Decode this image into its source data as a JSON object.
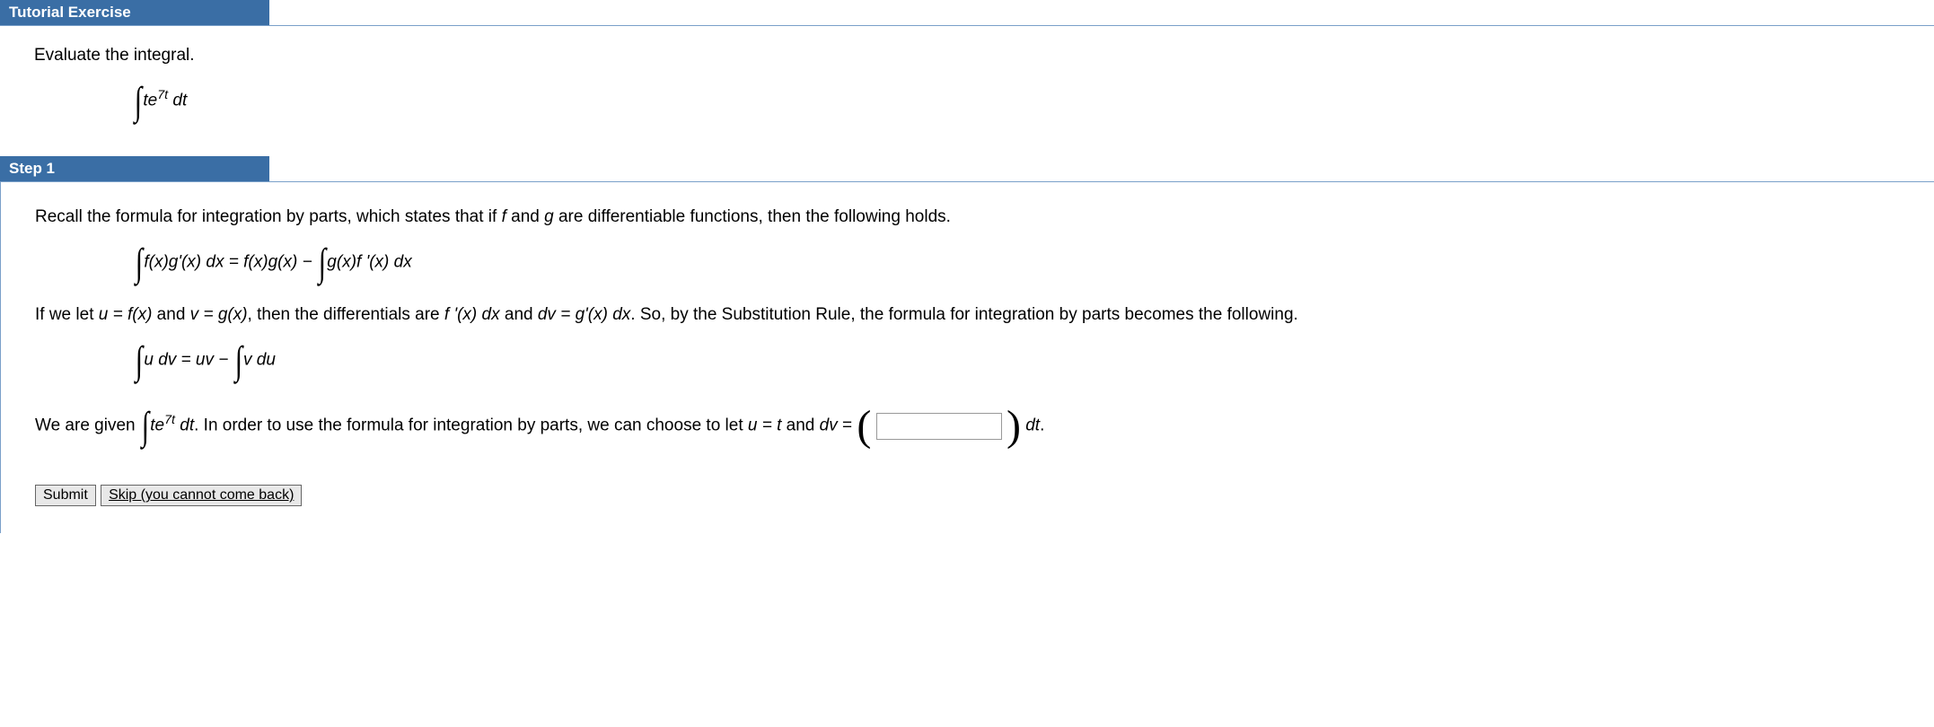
{
  "headers": {
    "tutorial": "Tutorial Exercise",
    "step1": "Step 1"
  },
  "exercise": {
    "prompt": "Evaluate the integral.",
    "integrand_base": "te",
    "integrand_exp": "7t",
    "differential": " dt"
  },
  "step1": {
    "intro_a": "Recall the formula for integration by parts, which states that if ",
    "intro_f": "f",
    "intro_b": " and ",
    "intro_g": "g",
    "intro_c": " are differentiable functions, then the following holds.",
    "formula1_lhs": "f(x)g'(x) dx",
    "formula1_eq": " = ",
    "formula1_mid": "f(x)g(x)",
    "formula1_minus": " − ",
    "formula1_rhs": "g(x)f '(x) dx",
    "para2_a": "If we let ",
    "para2_u": "u = f(x)",
    "para2_b": " and ",
    "para2_v": "v = g(x)",
    "para2_c": ", then the differentials are ",
    "para2_diff1": "f '(x) dx",
    "para2_d": " and ",
    "para2_diff2": "dv = g'(x) dx",
    "para2_e": ". So, by the Substitution Rule, the formula for integration by parts becomes the following.",
    "formula2_lhs": "u dv",
    "formula2_eq": " = ",
    "formula2_mid": "uv",
    "formula2_minus": " − ",
    "formula2_rhs": "v du",
    "para3_a": "We are given  ",
    "para3_int_base": "te",
    "para3_int_exp": "7t",
    "para3_int_diff": " dt",
    "para3_b": ". In order to use the formula for integration by parts, we can choose to let ",
    "para3_u": "u = t",
    "para3_c": " and ",
    "para3_dv": "dv",
    "para3_d": " = ",
    "para3_after_input": " dt",
    "para3_period": "."
  },
  "buttons": {
    "submit": "Submit",
    "skip": "Skip (you cannot come back)"
  }
}
